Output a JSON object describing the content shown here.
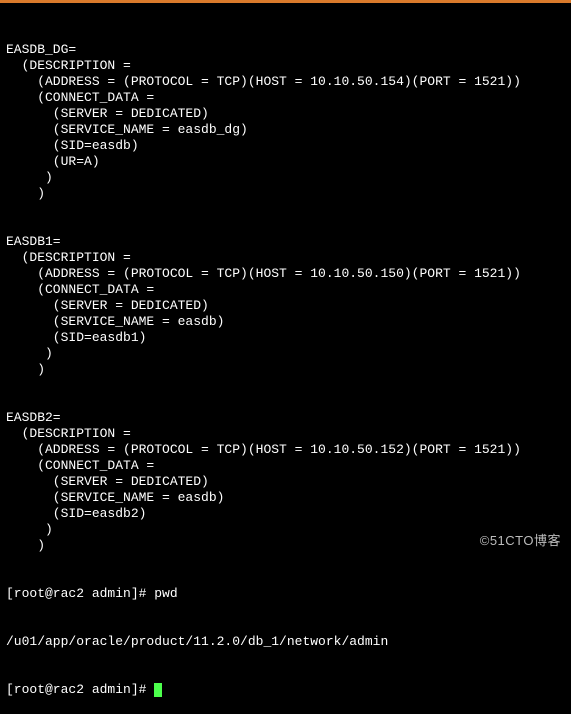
{
  "entries": [
    {
      "name": "EASDB_DG",
      "host": "10.10.50.154",
      "port": "1521",
      "service_name": "easdb_dg",
      "sid": "easdb",
      "extra": "(UR=A)"
    },
    {
      "name": "EASDB1",
      "host": "10.10.50.150",
      "port": "1521",
      "service_name": "easdb",
      "sid": "easdb1",
      "extra": null
    },
    {
      "name": "EASDB2",
      "host": "10.10.50.152",
      "port": "1521",
      "service_name": "easdb",
      "sid": "easdb2",
      "extra": null
    }
  ],
  "lines": [
    "EASDB_DG=",
    "  (DESCRIPTION =",
    "    (ADDRESS = (PROTOCOL = TCP)(HOST = 10.10.50.154)(PORT = 1521))",
    "    (CONNECT_DATA =",
    "      (SERVER = DEDICATED)",
    "      (SERVICE_NAME = easdb_dg)",
    "      (SID=easdb)",
    "      (UR=A)",
    "     )",
    "    )",
    "",
    "",
    "EASDB1=",
    "  (DESCRIPTION =",
    "    (ADDRESS = (PROTOCOL = TCP)(HOST = 10.10.50.150)(PORT = 1521))",
    "    (CONNECT_DATA =",
    "      (SERVER = DEDICATED)",
    "      (SERVICE_NAME = easdb)",
    "      (SID=easdb1)",
    "     )",
    "    )",
    "",
    "",
    "EASDB2=",
    "  (DESCRIPTION =",
    "    (ADDRESS = (PROTOCOL = TCP)(HOST = 10.10.50.152)(PORT = 1521))",
    "    (CONNECT_DATA =",
    "      (SERVER = DEDICATED)",
    "      (SERVICE_NAME = easdb)",
    "      (SID=easdb2)",
    "     )",
    "    )"
  ],
  "prompt1": {
    "userhost": "[root@rac2 admin]# ",
    "command": "pwd"
  },
  "pwd_output": "/u01/app/oracle/product/11.2.0/db_1/network/admin",
  "prompt2": {
    "userhost": "[root@rac2 admin]# "
  },
  "watermark": "©51CTO博客"
}
